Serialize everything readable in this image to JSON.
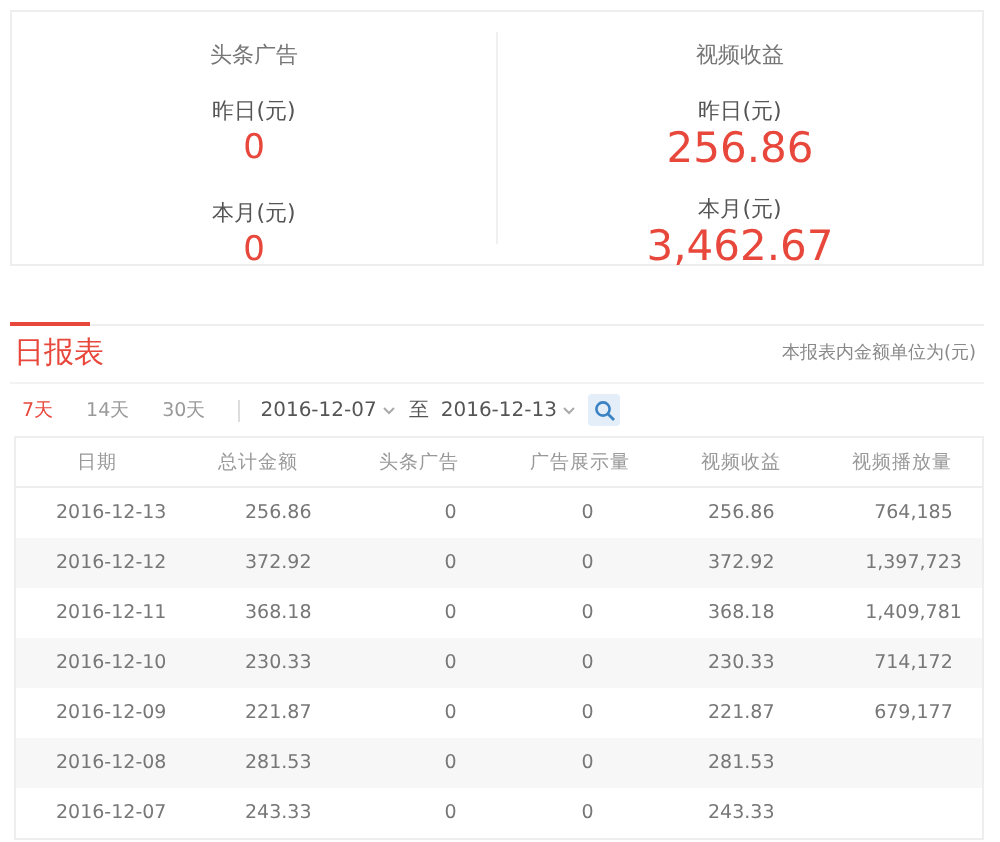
{
  "summary": [
    {
      "title": "头条广告",
      "stats": [
        {
          "label": "昨日(元)",
          "value": "0"
        },
        {
          "label": "本月(元)",
          "value": "0"
        }
      ]
    },
    {
      "title": "视频收益",
      "stats": [
        {
          "label": "昨日(元)",
          "value": "256.86"
        },
        {
          "label": "本月(元)",
          "value": "3,462.67"
        }
      ]
    }
  ],
  "report": {
    "title": "日报表",
    "note": "本报表内金额单位为(元)",
    "ranges": [
      {
        "label": "7天",
        "selected": true
      },
      {
        "label": "14天",
        "selected": false
      },
      {
        "label": "30天",
        "selected": false
      }
    ],
    "start_date": "2016-12-07",
    "to_label": "至",
    "end_date": "2016-12-13",
    "table": {
      "columns": [
        "日期",
        "总计金额",
        "头条广告",
        "广告展示量",
        "视频收益",
        "视频播放量"
      ],
      "rows": [
        [
          "2016-12-13",
          "256.86",
          "0",
          "0",
          "256.86",
          "764,185"
        ],
        [
          "2016-12-12",
          "372.92",
          "0",
          "0",
          "372.92",
          "1,397,723"
        ],
        [
          "2016-12-11",
          "368.18",
          "0",
          "0",
          "368.18",
          "1,409,781"
        ],
        [
          "2016-12-10",
          "230.33",
          "0",
          "0",
          "230.33",
          "714,172"
        ],
        [
          "2016-12-09",
          "221.87",
          "0",
          "0",
          "221.87",
          "679,177"
        ],
        [
          "2016-12-08",
          "281.53",
          "0",
          "0",
          "281.53"
        ],
        [
          "2016-12-07",
          "243.33",
          "0",
          "0",
          "243.33"
        ]
      ]
    }
  }
}
